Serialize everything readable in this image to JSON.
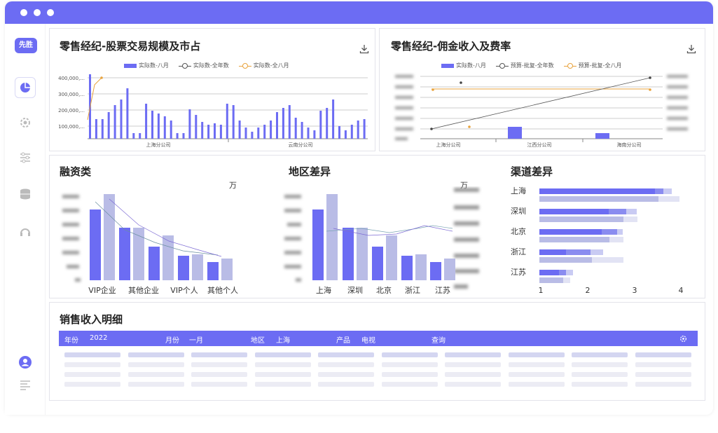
{
  "window": {
    "title_dots": 3
  },
  "sidebar": {
    "logo": "先胜",
    "items": [
      {
        "name": "dashboard-icon",
        "active": true
      },
      {
        "name": "gear-icon"
      },
      {
        "name": "sliders-icon"
      },
      {
        "name": "database-icon"
      },
      {
        "name": "headset-icon"
      }
    ],
    "bottom": [
      {
        "name": "user-icon"
      },
      {
        "name": "menu-icon"
      }
    ]
  },
  "panel1": {
    "title": "零售经纪-股票交易规模及市占",
    "legend": [
      "实际数-八月",
      "实际数-全年数",
      "实际数-全八月"
    ],
    "yticks": [
      "400,000,...",
      "300,000,...",
      "200,000,...",
      "100,000,..."
    ],
    "groups": [
      "上海分公司",
      "云南分公司"
    ]
  },
  "panel2": {
    "title": "零售经纪-佣金收入及费率",
    "legend": [
      "实际数-八月",
      "预算-批复-全年数",
      "预算-批复-全八月"
    ],
    "categories": [
      "上海分公司",
      "江西分公司",
      "海南分公司"
    ]
  },
  "panel3": {
    "title": "融资类",
    "unit": "万",
    "categories": [
      "VIP企业",
      "其他企业",
      "VIP个人",
      "其他个人"
    ]
  },
  "panel4": {
    "title": "地区差异",
    "unit": "万",
    "categories": [
      "上海",
      "深圳",
      "北京",
      "浙江",
      "江苏"
    ]
  },
  "panel5": {
    "title": "渠道差异",
    "categories": [
      "上海",
      "深圳",
      "北京",
      "浙江",
      "江苏"
    ],
    "xticks": [
      "1",
      "2",
      "3",
      "4"
    ]
  },
  "table": {
    "title": "销售收入明细",
    "filters": {
      "year_label": "年份",
      "year_value": "2022",
      "month_label": "月份",
      "month_value": "一月",
      "region_label": "地区",
      "region_value": "上海",
      "product_label": "产品",
      "product_value": "电视",
      "query_label": "查询"
    }
  },
  "colors": {
    "accent": "#6c6cf3",
    "accent_light": "#b9bce6",
    "orange": "#e8a33d"
  }
}
